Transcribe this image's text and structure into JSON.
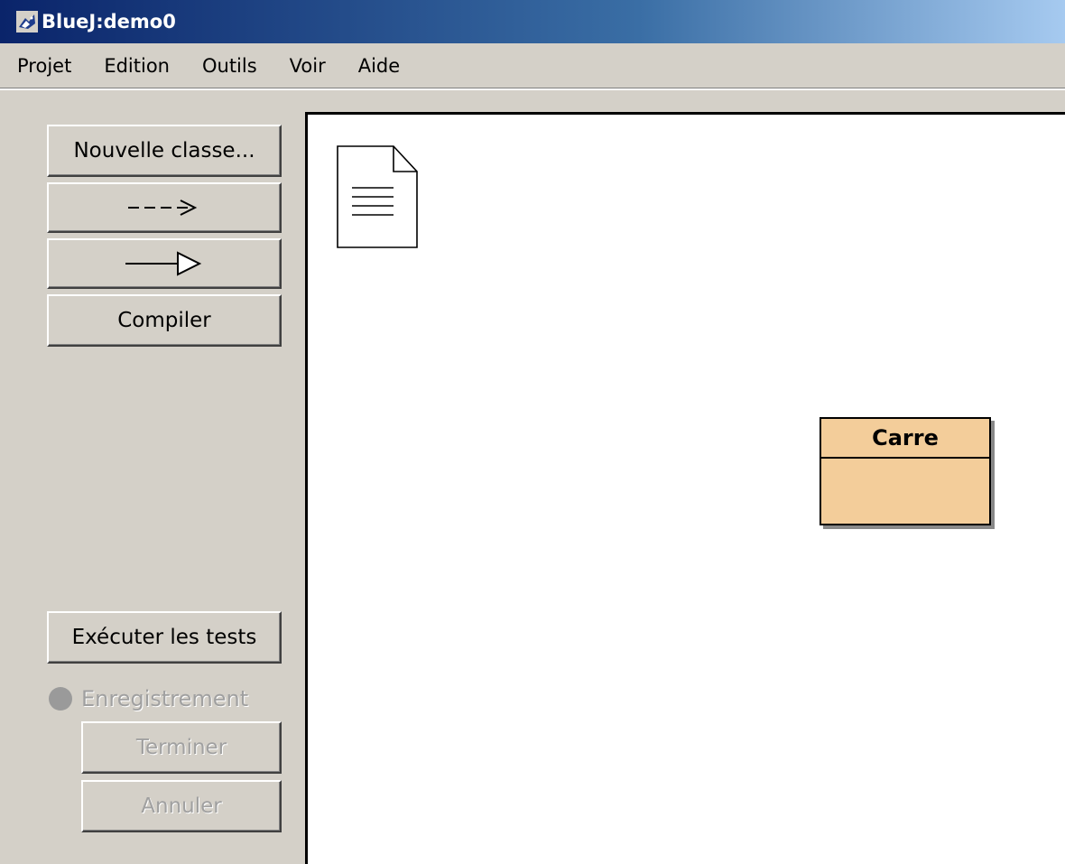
{
  "window": {
    "title": "BlueJ:demo0"
  },
  "menu": [
    "Projet",
    "Edition",
    "Outils",
    "Voir",
    "Aide"
  ],
  "toolbar": {
    "new_class_label": "Nouvelle classe...",
    "uses_arrow_label": "--->",
    "inherits_arrow_label": "—▷",
    "compile_label": "Compiler"
  },
  "testing": {
    "run_tests_label": "Exécuter les tests",
    "recording_label": "Enregistrement",
    "end_label": "Terminer",
    "cancel_label": "Annuler"
  },
  "diagram": {
    "classes": [
      {
        "name": "Carre",
        "color": "#f3cd9a"
      }
    ]
  },
  "colors": {
    "titlebar_start": "#0a246a",
    "chrome": "#d4d0c8",
    "class_fill": "#f3cd9a"
  }
}
